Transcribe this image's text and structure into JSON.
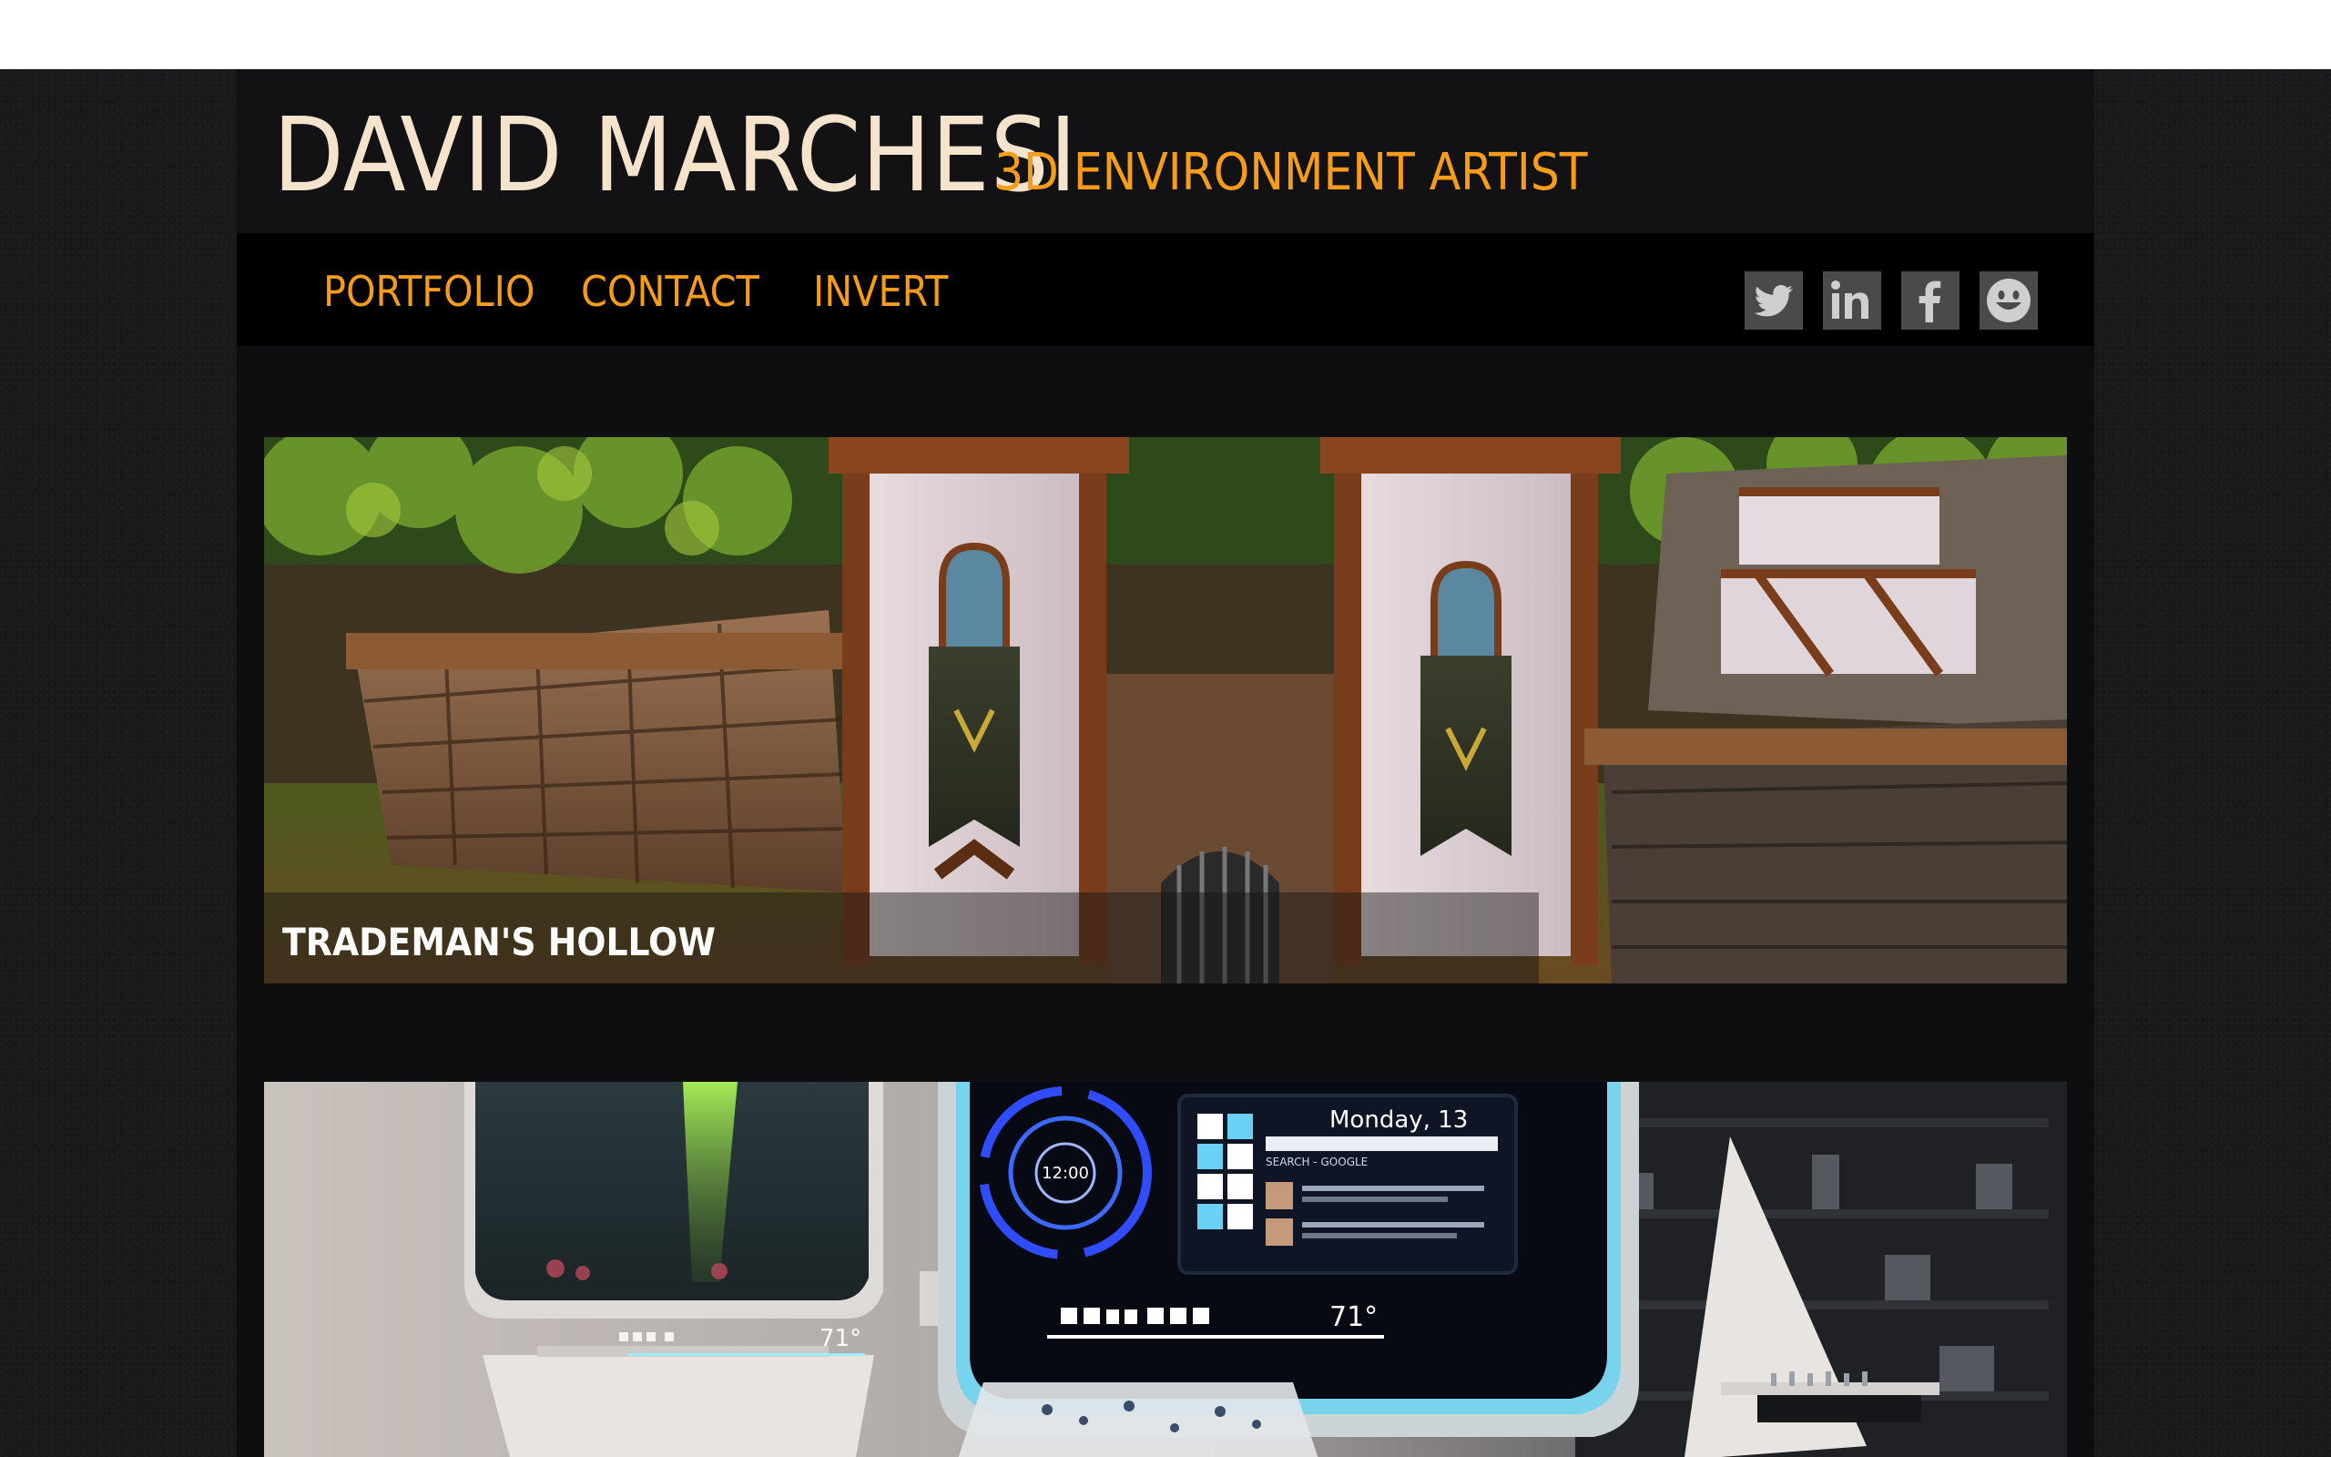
{
  "site": {
    "name": "DAVID MARCHESI",
    "tagline": "3D ENVIRONMENT ARTIST"
  },
  "nav": {
    "links": [
      {
        "label": "PORTFOLIO"
      },
      {
        "label": "CONTACT"
      },
      {
        "label": "INVERT"
      }
    ]
  },
  "social": {
    "icons": [
      "twitter-icon",
      "linkedin-icon",
      "facebook-icon",
      "smiley-icon"
    ]
  },
  "projects": [
    {
      "title": "TRADEMAN'S HOLLOW"
    },
    {
      "title": "",
      "screen": {
        "date": "Monday, 13",
        "search": "SEARCH - GOOGLE",
        "clock": "12:00",
        "temperature": "71°"
      }
    }
  ],
  "colors": {
    "accent": "#f59c1a",
    "name": "#f5e3cc",
    "background": "#0e0e11",
    "nav_background": "#000000",
    "social_icon_bg": "#4a4a4a"
  }
}
